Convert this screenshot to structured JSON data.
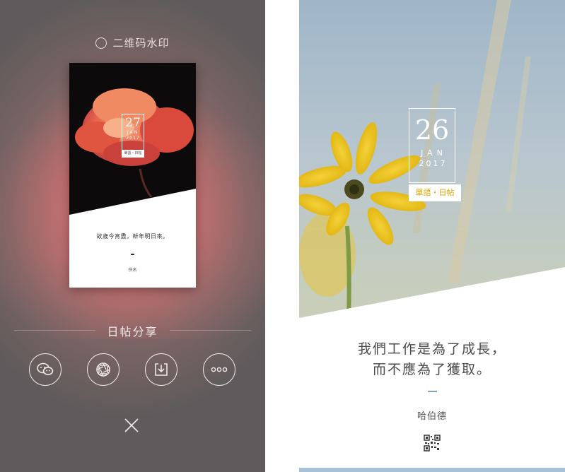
{
  "left_panel": {
    "watermark_option": "二维码水印",
    "card": {
      "day": "27",
      "month": "JAN",
      "year": "2017",
      "tag": "單語・日帖",
      "quote": "故歲今宵盡，新年明日來。",
      "author": "佚名"
    },
    "share_title": "日帖分享",
    "share_buttons": [
      "wechat",
      "moments",
      "save",
      "more"
    ]
  },
  "right_panel": {
    "day": "26",
    "month": "JAN",
    "year": "2017",
    "tag": "單語・日帖",
    "quote_line1": "我們工作是為了成長，",
    "quote_line2": "而不應為了獲取。",
    "author": "哈伯德"
  },
  "colors": {
    "tag_accent": "#e0a200",
    "dash_accent": "#7fa7c4"
  },
  "icons": [
    "wechat-icon",
    "moments-icon",
    "download-icon",
    "more-icon",
    "close-icon",
    "qr-code-icon"
  ]
}
